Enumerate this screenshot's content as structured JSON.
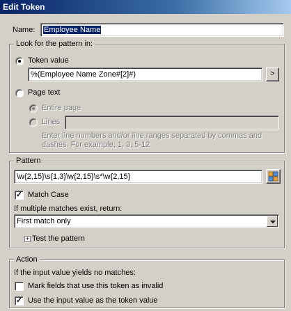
{
  "window": {
    "title": "Edit Token"
  },
  "name_field": {
    "label": "Name:",
    "value": "Employee Name"
  },
  "look_for": {
    "group_title": "Look for the pattern in:",
    "token_value": {
      "label": "Token value",
      "selected": true,
      "value": "%(Employee Name Zone#[2]#)",
      "button_label": ">"
    },
    "page_text": {
      "label": "Page text",
      "selected": false,
      "entire_page_label": "Entire page",
      "lines_label": "Lines:",
      "lines_value": "",
      "hint_line1": "Enter line numbers and/or line ranges separated by commas and",
      "hint_line2": "dashes.  For example, 1, 3, 5-12"
    }
  },
  "pattern": {
    "group_title": "Pattern",
    "value": "\\w{2,15}\\s{1,3}\\w{2,15}\\s*\\w{2,15}",
    "match_case": {
      "label": "Match Case",
      "checked": true
    },
    "multiple_matches_label": "If multiple matches exist, return:",
    "multiple_matches_selected": "First match only",
    "test_pattern_label": "Test the pattern"
  },
  "action": {
    "group_title": "Action",
    "no_match_label": "If the input value yields no matches:",
    "mark_invalid": {
      "label": "Mark fields that use this token as invalid",
      "checked": false
    },
    "use_input": {
      "label": "Use the input value as the token value",
      "checked": true
    }
  },
  "colors": {
    "title_bar": "#0a246a",
    "dialog_bg": "#d4d0c8",
    "selection": "#0a246a"
  }
}
